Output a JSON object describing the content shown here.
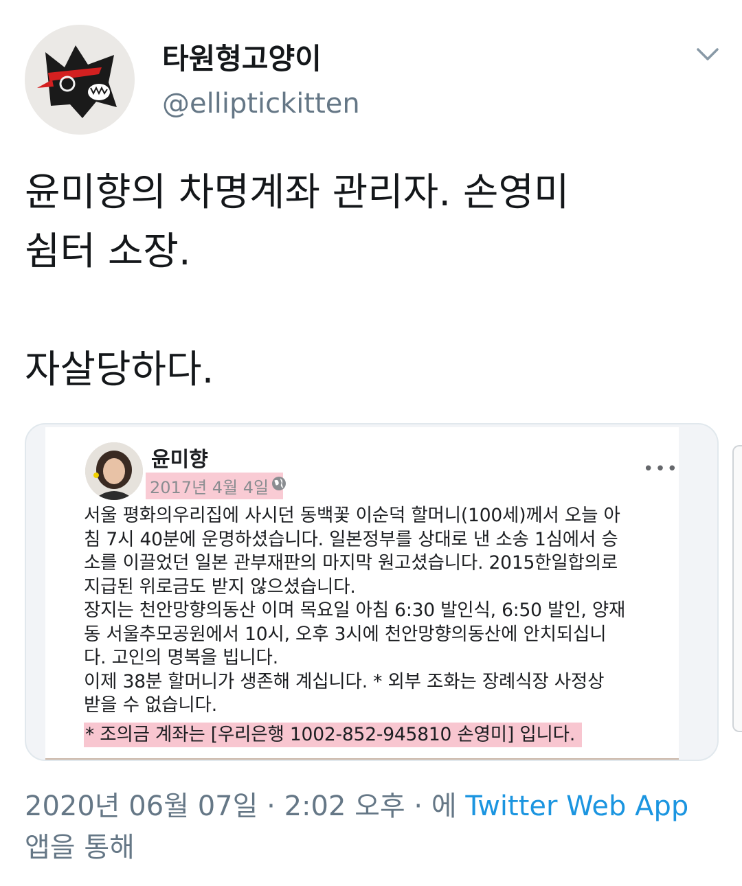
{
  "tweet": {
    "author": {
      "display_name": "타원형고양이",
      "handle": "@elliptickitten",
      "avatar_icon": "cat-avatar-icon"
    },
    "menu_icon": "chevron-down-icon",
    "text": "윤미향의 차명계좌 관리자. 손영미\n쉼터 소장.\n\n자살당하다.",
    "timestamp": "2020년 06월 07일 · 2:02 오후 · 에",
    "source": "Twitter Web App",
    "source_suffix": "앱을 통해",
    "link_color": "#1b95e0"
  },
  "embedded_post": {
    "author_name": "윤미향",
    "date": "2017년 4월 4일 ·",
    "privacy_icon": "globe-icon",
    "more_icon": "ellipsis-icon",
    "more_label": "•••",
    "body": "서울 평화의우리집에 사시던 동백꽃 이순덕 할머니(100세)께서 오늘 아\n침 7시 40분에 운명하셨습니다.  일본정부를 상대로 낸 소송 1심에서 승\n소를 이끌었던 일본 관부재판의 마지막 원고셨습니다. 2015한일합의로\n지급된 위로금도 받지 않으셨습니다.\n장지는 천안망향의동산 이며 목요일 아침 6:30 발인식, 6:50 발인, 양재\n동 서울추모공원에서 10시, 오후 3시에 천안망향의동산에 안치되십니\n다.  고인의 명복을 빕니다.\n이제 38분 할머니가 생존해 계십니다.  * 외부 조화는 장례식장 사정상\n받을 수 없습니다.",
    "highlight": "* 조의금 계좌는 [우리은행 1002-852-945810 손영미] 입니다.",
    "highlight_color": "#f4a0b0"
  }
}
